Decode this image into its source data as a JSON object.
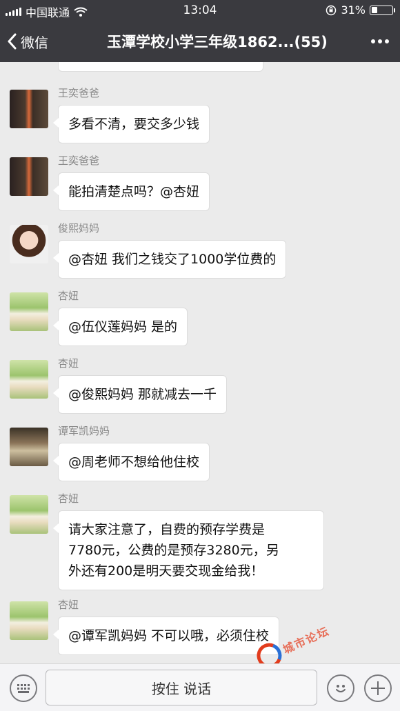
{
  "status_bar": {
    "carrier": "中国联通",
    "time": "13:04",
    "battery": "31%",
    "battery_level": 0.31
  },
  "nav": {
    "back_label": "微信",
    "title": "玉潭学校小学三年级1862...(55)"
  },
  "messages": [
    {
      "sender": "王奕爸爸",
      "text": "多看不清，要交多少钱",
      "avatar": "pen-light-photo"
    },
    {
      "sender": "王奕爸爸",
      "text": "能拍清楚点吗？@杏妞",
      "avatar": "pen-light-photo"
    },
    {
      "sender": "俊熙妈妈",
      "text": "@杏妞 我们之钱交了1000学位费的",
      "avatar": "woman-portrait-photo"
    },
    {
      "sender": "杏妞",
      "text": "@伍仪莲妈妈 是的",
      "avatar": "field-girl-photo"
    },
    {
      "sender": "杏妞",
      "text": "@俊熙妈妈 那就减去一千",
      "avatar": "field-girl-photo"
    },
    {
      "sender": "谭军凯妈妈",
      "text": "@周老师不想给他住校",
      "avatar": "group-photo"
    },
    {
      "sender": "杏妞",
      "lines": [
        "请大家注意了，自费的预存学费是",
        "7780元，公费的是预存3280元，另",
        "外还有200是明天要交现金给我！"
      ],
      "avatar": "field-girl-photo"
    },
    {
      "sender": "杏妞",
      "text": "@谭军凯妈妈 不可以哦，必须住校",
      "avatar": "field-girl-photo"
    }
  ],
  "input_bar": {
    "hold_to_talk": "按住 说话"
  },
  "watermark": {
    "text": "城市论坛"
  }
}
